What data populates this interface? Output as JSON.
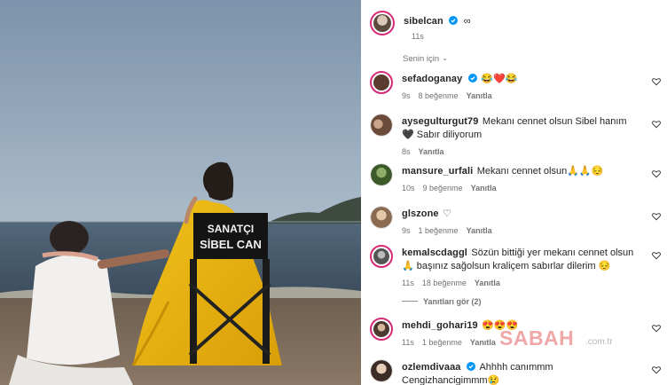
{
  "post": {
    "username": "sibelcan",
    "suffix": "∞",
    "time": "11s"
  },
  "sort_label": "Senin için",
  "photo": {
    "chair_line1": "SANATÇI",
    "chair_line2": "SİBEL CAN"
  },
  "comments": [
    {
      "username": "sefadoganay",
      "verified": true,
      "text": "😂❤️😂",
      "time": "9s",
      "likes": "8 beğenme",
      "reply": "Yanıtla"
    },
    {
      "username": "aysegulturgut79",
      "verified": false,
      "text": "Mekanı cennet olsun Sibel hanım 🖤 Sabır diliyorum",
      "time": "8s",
      "likes": "",
      "reply": "Yanıtla"
    },
    {
      "username": "mansure_urfali",
      "verified": false,
      "text": "Mekanı cennet olsun🙏🙏😔",
      "time": "10s",
      "likes": "9 beğenme",
      "reply": "Yanıtla"
    },
    {
      "username": "glszone",
      "verified": false,
      "text": "♡",
      "time": "9s",
      "likes": "1 beğenme",
      "reply": "Yanıtla"
    },
    {
      "username": "kemalscdaggl",
      "verified": false,
      "text": "Sözün bittiği yer mekanı cennet olsun 🙏 başınız sağolsun kraliçem sabırlar dilerim 😔",
      "time": "11s",
      "likes": "18 beğenme",
      "reply": "Yanıtla"
    },
    {
      "username": "mehdi_gohari19",
      "verified": false,
      "text": "😍😍😍",
      "time": "11s",
      "likes": "1 beğenme",
      "reply": "Yanıtla"
    },
    {
      "username": "ozlemdivaaa",
      "verified": true,
      "text": "Ahhhh canımmm Cengizhancigimmm😢",
      "time": "",
      "likes": "",
      "reply": ""
    }
  ],
  "replies_toggle": "Yanıtları gör (2)",
  "watermark": {
    "brand": "SABAH",
    "site": ".com.tr"
  },
  "colors": {
    "verified": "#0095f6",
    "story_ring": "#d62976",
    "meta": "#737373"
  }
}
